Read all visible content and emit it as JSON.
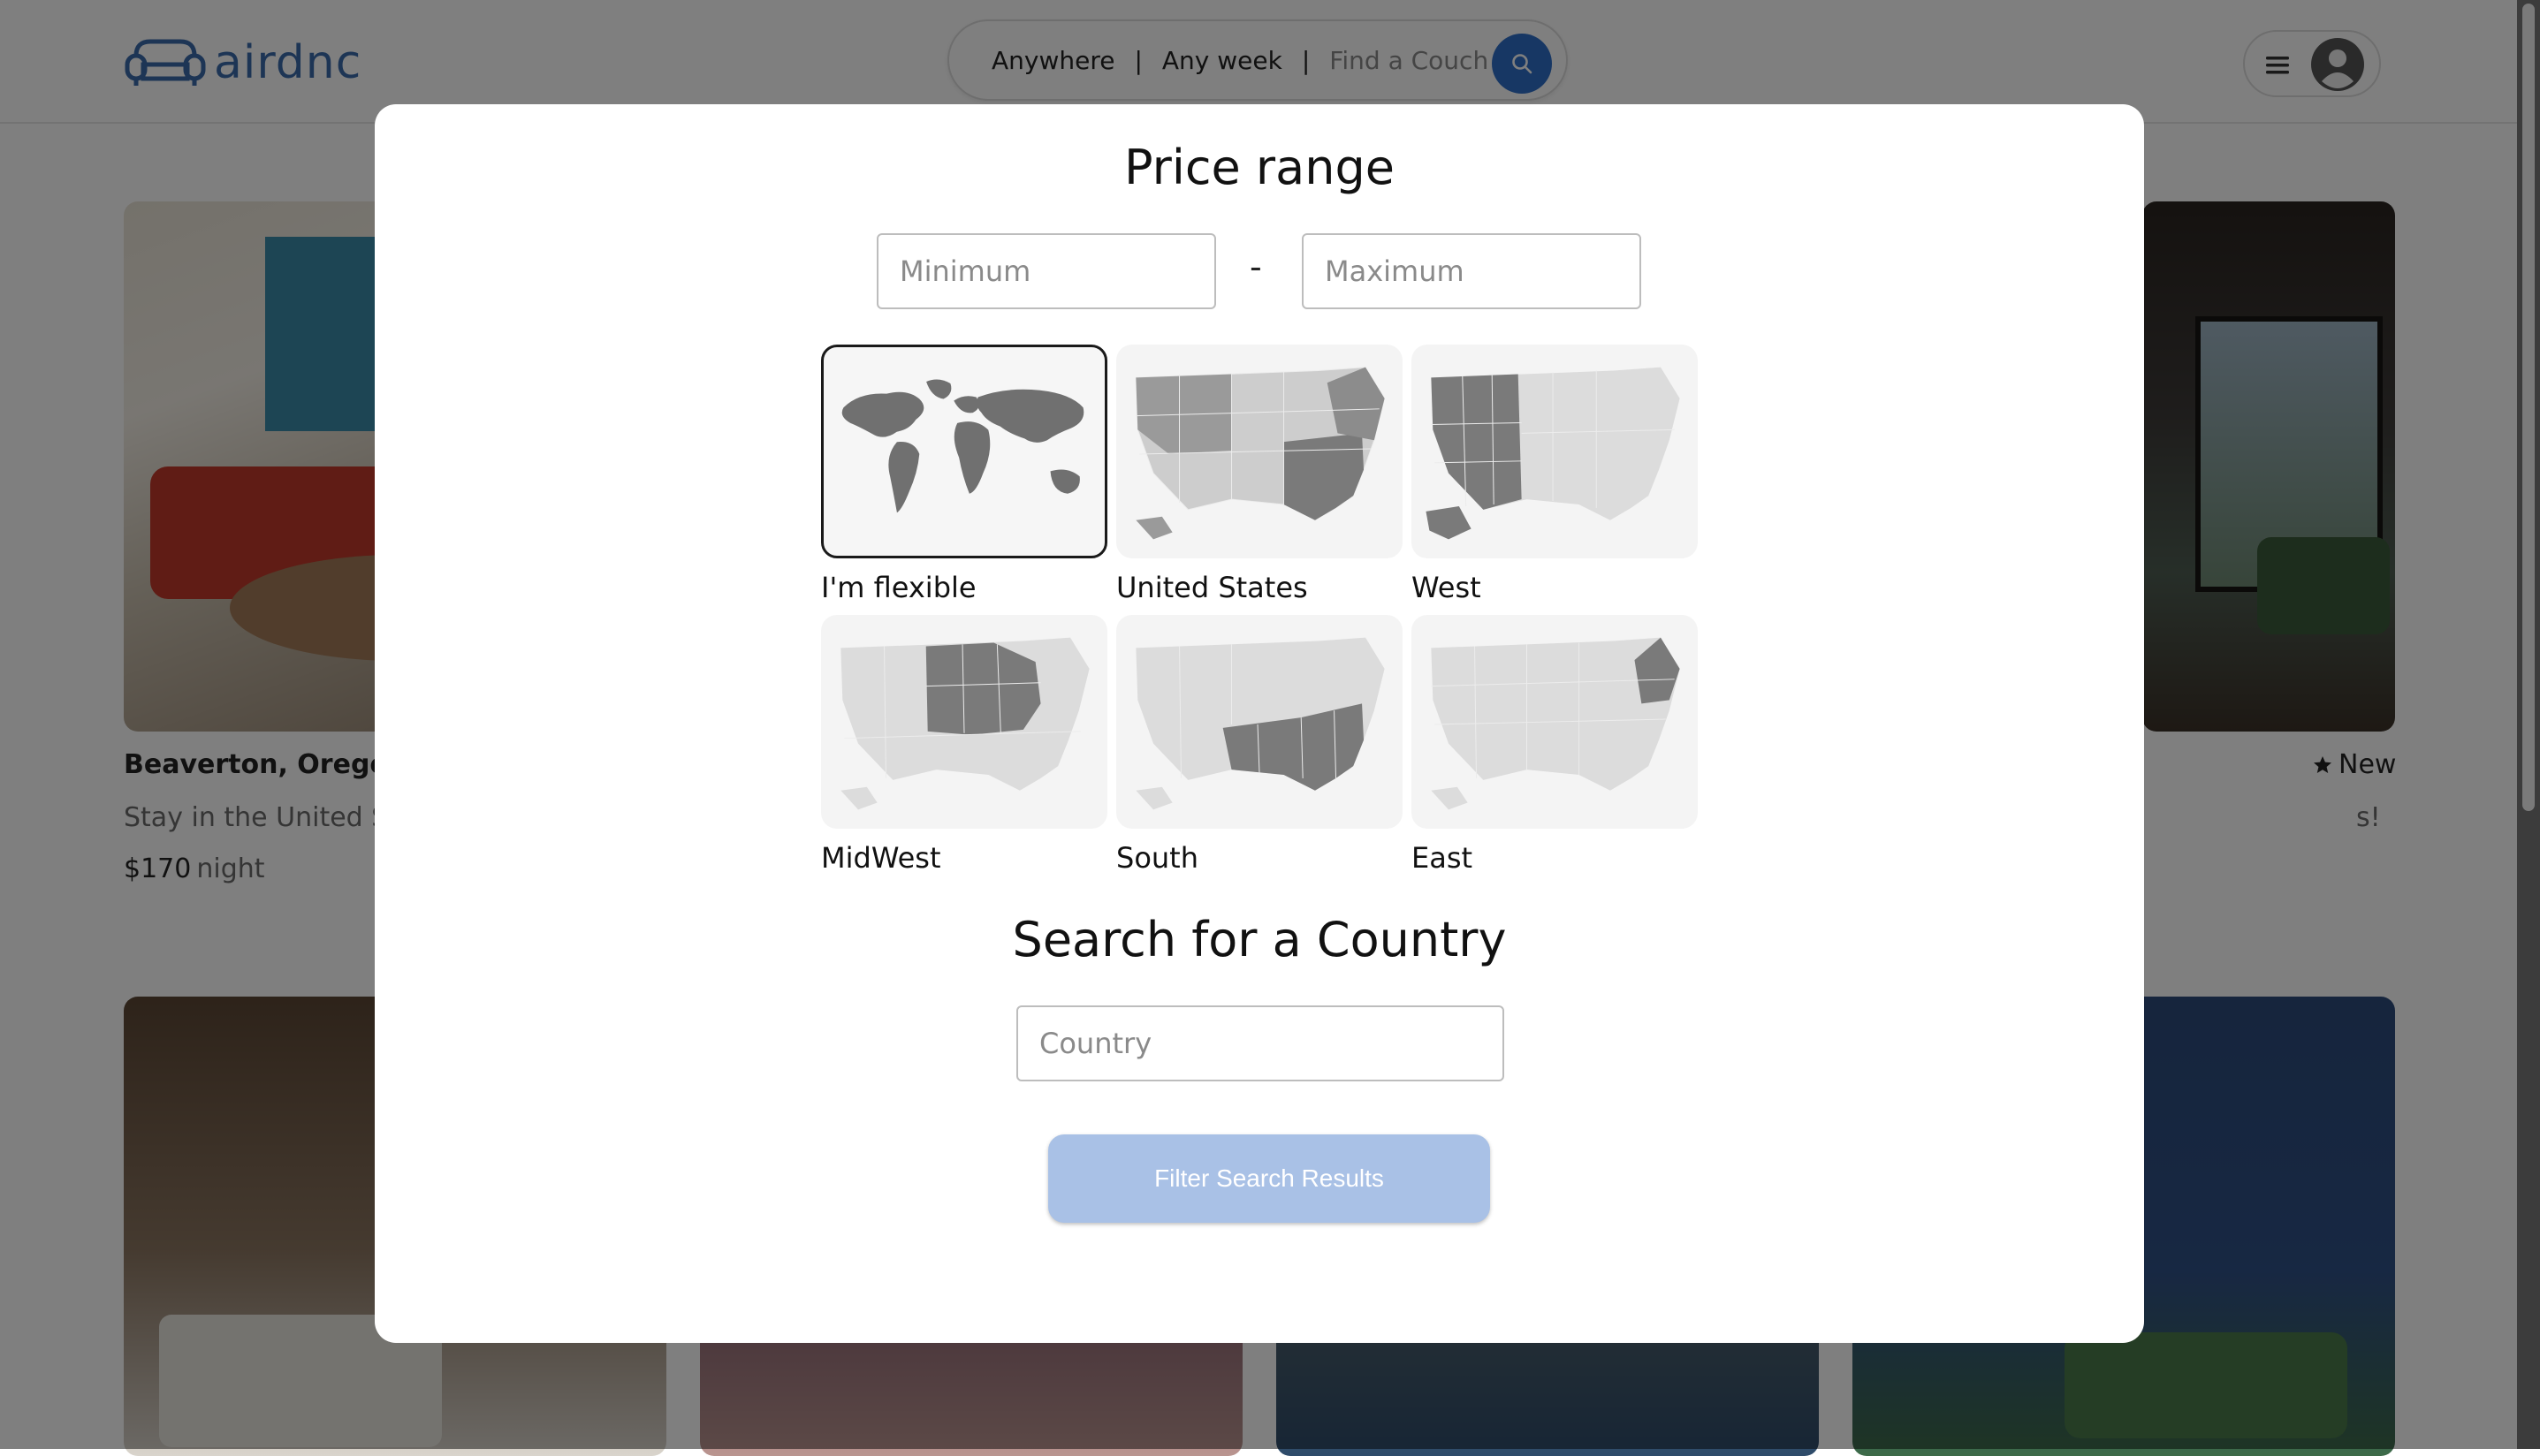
{
  "header": {
    "logo_text": "airdnc",
    "search": {
      "anywhere": "Anywhere",
      "any_week": "Any week",
      "separator": "|",
      "find_placeholder": "Find a Couch"
    }
  },
  "listings": [
    {
      "title": "Beaverton, Oregon",
      "subtitle": "Stay in the United St",
      "price": "$170",
      "price_unit": "night"
    },
    {
      "rating_label": "New",
      "subtitle_fragment": "s!"
    }
  ],
  "modal": {
    "title": "Price range",
    "min_placeholder": "Minimum",
    "max_placeholder": "Maximum",
    "dash": "-",
    "regions": [
      {
        "label": "I'm flexible",
        "selected": true
      },
      {
        "label": "United States",
        "selected": false
      },
      {
        "label": "West",
        "selected": false
      },
      {
        "label": "MidWest",
        "selected": false
      },
      {
        "label": "South",
        "selected": false
      },
      {
        "label": "East",
        "selected": false
      }
    ],
    "country_title": "Search for a Country",
    "country_placeholder": "Country",
    "filter_button": "Filter Search Results"
  },
  "colors": {
    "brand": "#3a6aaa",
    "search_button": "#2f6fc8",
    "filter_button": "#a9c1e6",
    "map_highlight": "#7a7a7a",
    "map_base": "#d2d2d2"
  }
}
